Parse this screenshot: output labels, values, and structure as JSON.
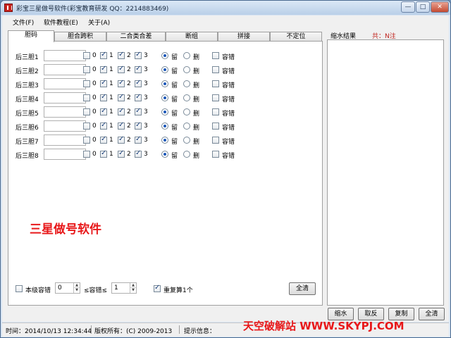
{
  "window": {
    "title": "彩宝三星做号软件(彩宝教育研发 QQ：2214883469)",
    "controls": {
      "minimize": "—",
      "maximize": "□",
      "close": "✕"
    }
  },
  "menu": [
    "文件(F)",
    "软件教程(E)",
    "关于(A)"
  ],
  "tabs": [
    {
      "label": "胆码",
      "active": true
    },
    {
      "label": "胆合跨积",
      "active": false
    },
    {
      "label": "二合类合差",
      "active": false
    },
    {
      "label": "断组",
      "active": false
    },
    {
      "label": "拼接",
      "active": false
    },
    {
      "label": "不定位",
      "active": false
    }
  ],
  "rows": [
    {
      "label": "后三胆1",
      "value": "",
      "checks": [
        false,
        true,
        true,
        true
      ],
      "keep": true
    },
    {
      "label": "后三胆2",
      "value": "",
      "checks": [
        false,
        true,
        true,
        true
      ],
      "keep": true
    },
    {
      "label": "后三胆3",
      "value": "",
      "checks": [
        false,
        true,
        true,
        true
      ],
      "keep": true
    },
    {
      "label": "后三胆4",
      "value": "",
      "checks": [
        false,
        true,
        true,
        true
      ],
      "keep": true
    },
    {
      "label": "后三胆5",
      "value": "",
      "checks": [
        false,
        true,
        true,
        true
      ],
      "keep": true
    },
    {
      "label": "后三胆6",
      "value": "",
      "checks": [
        false,
        true,
        true,
        true
      ],
      "keep": true
    },
    {
      "label": "后三胆7",
      "value": "",
      "checks": [
        false,
        true,
        true,
        true
      ],
      "keep": true
    },
    {
      "label": "后三胆8",
      "value": "",
      "checks": [
        false,
        true,
        true,
        true
      ],
      "keep": true
    }
  ],
  "row_options": {
    "check_labels": [
      "0",
      "1",
      "2",
      "3"
    ],
    "keep_label": "留",
    "delete_label": "删",
    "fault_label": "容错"
  },
  "watermark_center": "三星做号软件",
  "bottom": {
    "level_fault_label": "本级容错",
    "min_value": "0",
    "range_label": "≤容错≤",
    "max_value": "1",
    "recalc_label": "重复算1个",
    "recalc_checked": true,
    "clear_all": "全清"
  },
  "results": {
    "title": "缩水结果",
    "count": "共：N注",
    "buttons": [
      "缩水",
      "取反",
      "复制",
      "全清"
    ]
  },
  "status": {
    "time": "时间：2014/10/13 12:34:44",
    "copyright": "版权所有：(C) 2009-2013",
    "hint": "提示信息："
  },
  "watermark_bottom": "天空破解站 WWW.SKYPJ.COM"
}
